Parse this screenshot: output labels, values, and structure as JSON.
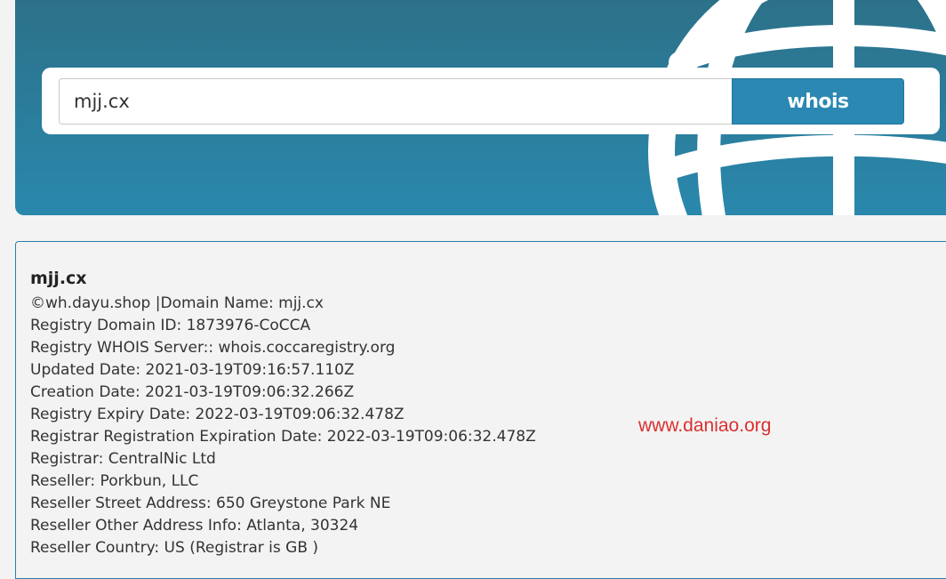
{
  "search": {
    "value": "mjj.cx",
    "button_label": "whois"
  },
  "result": {
    "title": "mjj.cx",
    "lines": [
      "©wh.dayu.shop |Domain Name: mjj.cx",
      "Registry Domain ID: 1873976-CoCCA",
      "Registry WHOIS Server:: whois.coccaregistry.org",
      "Updated Date: 2021-03-19T09:16:57.110Z",
      "Creation Date: 2021-03-19T09:06:32.266Z",
      "Registry Expiry Date: 2022-03-19T09:06:32.478Z",
      "Registrar Registration Expiration Date: 2022-03-19T09:06:32.478Z",
      "Registrar: CentralNic Ltd",
      "Reseller: Porkbun, LLC",
      "Reseller Street Address: 650 Greystone Park NE",
      "Reseller Other Address Info: Atlanta, 30324",
      "Reseller Country: US (Registrar is GB )"
    ]
  },
  "watermark": "www.daniao.org",
  "colors": {
    "hero_top": "#2c7189",
    "hero_bottom": "#2a88ad",
    "button": "#2a88b2",
    "watermark": "#d93030"
  },
  "icons": {
    "hero_graphic": "globe-icon"
  }
}
